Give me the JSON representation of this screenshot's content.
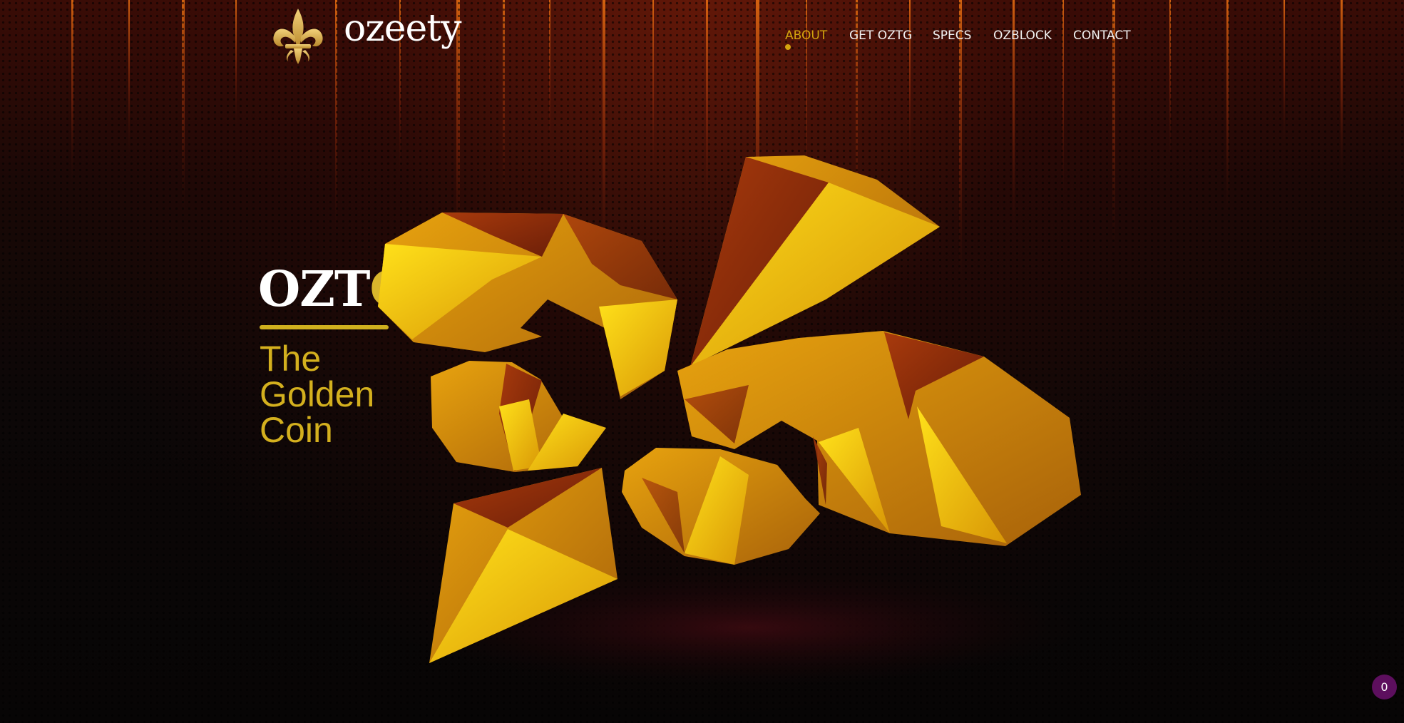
{
  "header": {
    "brand": "ozeety",
    "logo_icon": "fleur-de-lis-icon"
  },
  "nav": {
    "items": [
      {
        "label": "ABOUT",
        "active": true
      },
      {
        "label": "GET OZTG",
        "active": false
      },
      {
        "label": "SPECS",
        "active": false
      },
      {
        "label": "OZBLOCK",
        "active": false
      },
      {
        "label": "CONTACT",
        "active": false
      }
    ]
  },
  "hero": {
    "title_main": "OZT",
    "title_accent": "G",
    "subtitle": "The Golden Coin"
  },
  "badge": {
    "count": "0"
  },
  "colors": {
    "gold": "#d4b01e",
    "active_nav": "#d4a40e",
    "background": "#0a0606",
    "badge": "#5d0f5e"
  }
}
